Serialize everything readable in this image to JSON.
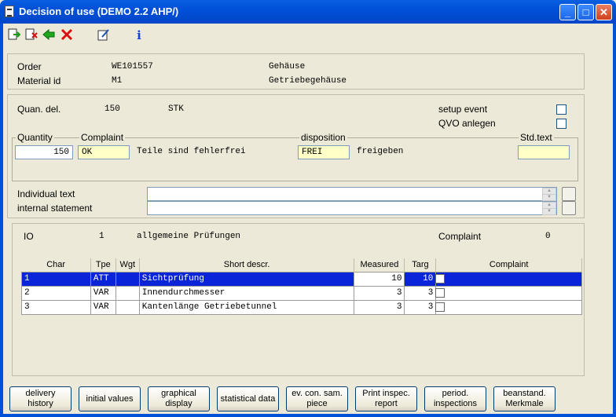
{
  "window": {
    "title": "Decision of use (DEMO 2.2 AHP/)",
    "minimize": "_",
    "maximize": "□",
    "close": "✕"
  },
  "toolbar": {
    "icons": [
      "exit-icon",
      "cancel-icon",
      "back-arrow-icon",
      "delete-icon",
      "edit-icon",
      "info-icon"
    ],
    "info_glyph": "i"
  },
  "header": {
    "order_label": "Order",
    "order_value": "WE101557",
    "order_desc": "Gehäuse",
    "material_label": "Material id",
    "material_value": "M1",
    "material_desc": "Getriebegehäuse"
  },
  "delivery": {
    "quan_label": "Quan. del.",
    "quan_value": "150",
    "unit": "STK",
    "setup_event_label": "setup event",
    "qvo_label": "QVO anlegen"
  },
  "decision": {
    "quantity_label": "Quantity",
    "quantity_value": "150",
    "complaint_label": "Complaint",
    "complaint_value": "OK",
    "complaint_text": "Teile sind fehlerfrei",
    "disposition_label": "disposition",
    "disposition_value": "FREI",
    "disposition_text": "freigeben",
    "std_text_label": "Std.text",
    "std_text_value": ""
  },
  "texts": {
    "individual_label": "Individual text",
    "internal_label": "internal statement"
  },
  "inspection": {
    "io_label": "IO",
    "io_value": "1",
    "io_desc": "allgemeine Prüfungen",
    "complaint_label": "Complaint",
    "complaint_value": "0",
    "columns": [
      "Char",
      "Tpe",
      "Wgt",
      "Short descr.",
      "Measured",
      "Targ",
      "Complaint"
    ],
    "rows": [
      {
        "char": "1",
        "type": "ATT",
        "wgt": "",
        "descr": "Sichtprüfung",
        "measured": "10",
        "targ": "10",
        "complaint": "",
        "selected": true
      },
      {
        "char": "2",
        "type": "VAR",
        "wgt": "",
        "descr": "Innendurchmesser",
        "measured": "3",
        "targ": "3",
        "complaint": "",
        "selected": false
      },
      {
        "char": "3",
        "type": "VAR",
        "wgt": "",
        "descr": "Kantenlänge Getriebetunnel",
        "measured": "3",
        "targ": "3",
        "complaint": "",
        "selected": false
      }
    ]
  },
  "buttons": {
    "delivery_history": "delivery history",
    "initial_values": "initial values",
    "graphical_display_1": "graphical",
    "graphical_display_2": "display",
    "statistical_data": "statistical data",
    "ev_con_1": "ev. con. sam.",
    "ev_con_2": "piece",
    "print_1": "Print inspec.",
    "print_2": "report",
    "period_1": "period.",
    "period_2": "inspections",
    "beanstand_1": "beanstand.",
    "beanstand_2": "Merkmale"
  }
}
